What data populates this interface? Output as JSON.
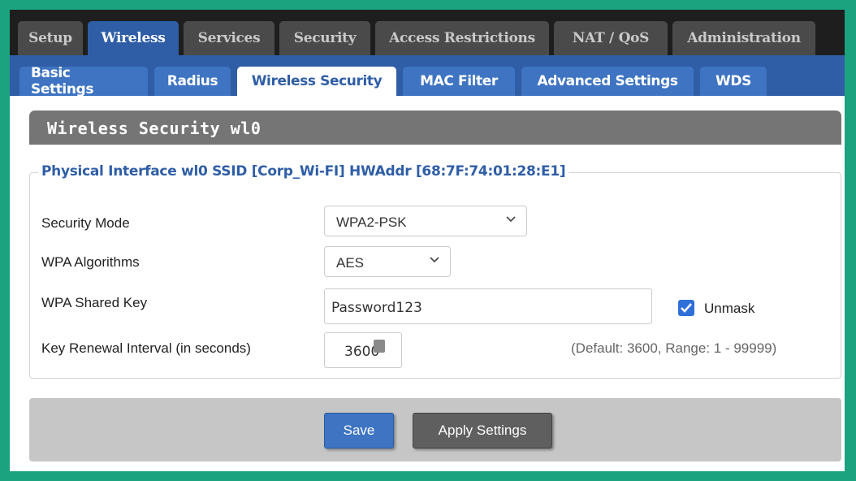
{
  "top_tabs": [
    {
      "label": "Setup",
      "active": false
    },
    {
      "label": "Wireless",
      "active": true
    },
    {
      "label": "Services",
      "active": false
    },
    {
      "label": "Security",
      "active": false
    },
    {
      "label": "Access Restrictions",
      "active": false
    },
    {
      "label": "NAT / QoS",
      "active": false
    },
    {
      "label": "Administration",
      "active": false
    }
  ],
  "sub_tabs": [
    {
      "label": "Basic Settings",
      "active": false
    },
    {
      "label": "Radius",
      "active": false
    },
    {
      "label": "Wireless Security",
      "active": true
    },
    {
      "label": "MAC Filter",
      "active": false
    },
    {
      "label": "Advanced Settings",
      "active": false
    },
    {
      "label": "WDS",
      "active": false
    }
  ],
  "panel": {
    "title": "Wireless Security wl0"
  },
  "fieldset": {
    "legend": "Physical Interface wl0 SSID [Corp_Wi-FI] HWAddr [68:7F:74:01:28:E1]"
  },
  "form": {
    "security_mode": {
      "label": "Security Mode",
      "value": "WPA2-PSK"
    },
    "wpa_algorithms": {
      "label": "WPA Algorithms",
      "value": "AES"
    },
    "wpa_shared_key": {
      "label": "WPA Shared Key",
      "value": "Password123",
      "unmask_label": "Unmask",
      "unmask_checked": true
    },
    "key_renewal": {
      "label": "Key Renewal Interval (in seconds)",
      "value": "3600",
      "hint": "(Default: 3600, Range: 1 - 99999)"
    }
  },
  "buttons": {
    "save": "Save",
    "apply": "Apply Settings"
  },
  "colors": {
    "frame": "#1aa37e",
    "accent": "#2f5ea6",
    "active_tab": "#2f5ea6",
    "panel_header": "#757575",
    "footer": "#c6c6c6"
  }
}
